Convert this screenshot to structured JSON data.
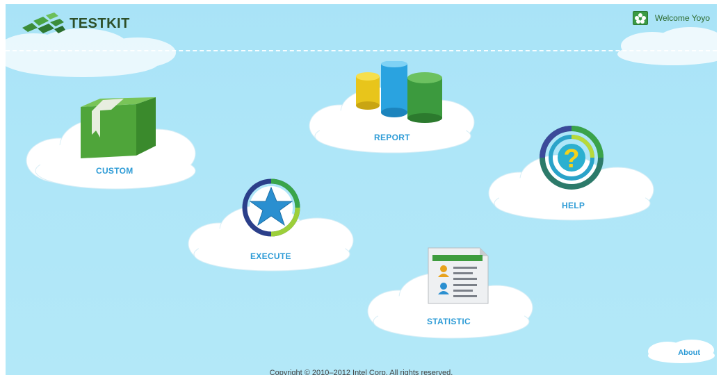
{
  "header": {
    "brand": "TESTKIT",
    "welcome": "Welcome Yoyo"
  },
  "menu": {
    "custom": "CUSTOM",
    "report": "REPORT",
    "help": "HELP",
    "execute": "EXECUTE",
    "statistic": "STATISTIC"
  },
  "about": "About",
  "footer": {
    "copyright": "Copyright © 2010–2012 Intel Corp. All rights reserved."
  }
}
